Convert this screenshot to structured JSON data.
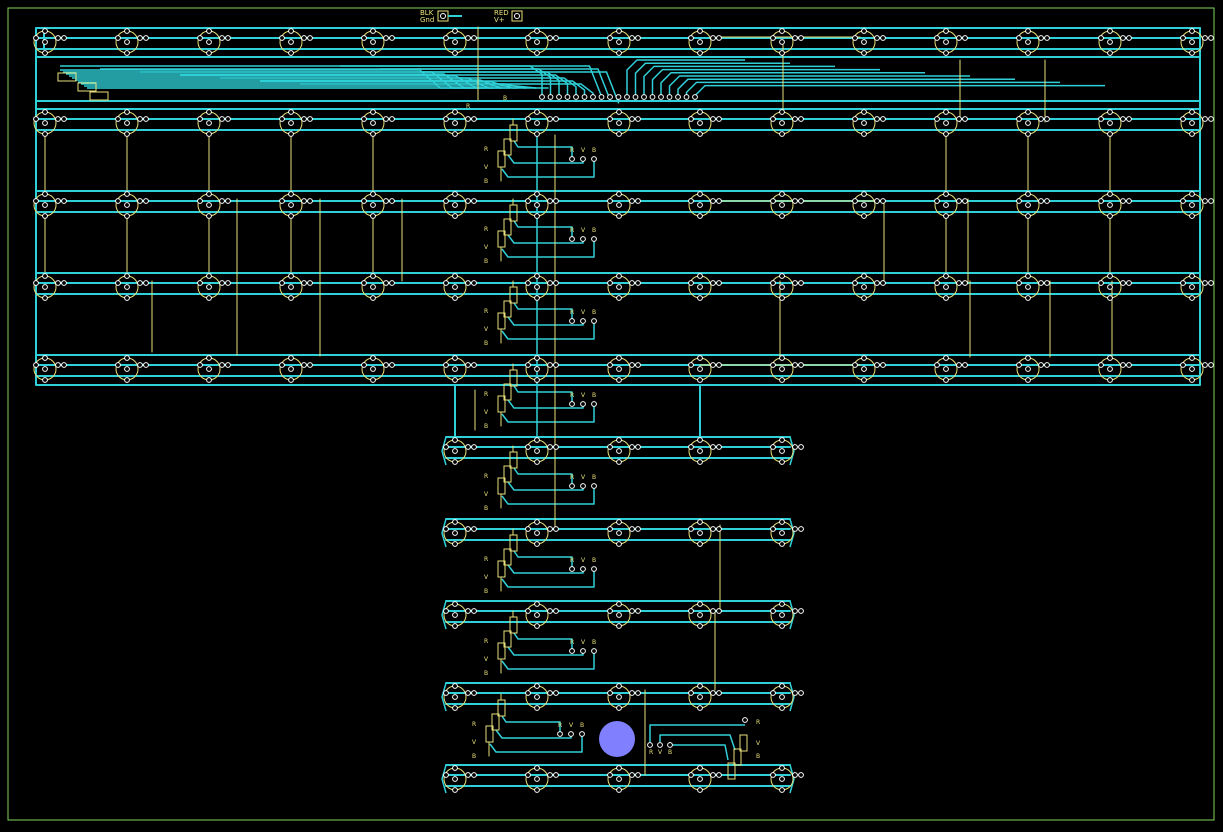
{
  "colors": {
    "background": "#000000",
    "board_outline": "#7ed957",
    "trace": "#2fd0d8",
    "silkscreen": "#e8e07a",
    "pad": "#ffffff",
    "highlight": "#8080ff"
  },
  "connector_labels": {
    "black": "BLK",
    "ground": "Gnd",
    "red": "RED",
    "v_plus": "V+"
  },
  "resistor_labels": {
    "r": "R",
    "v": "V",
    "b": "B"
  },
  "sections": {
    "top_array": "matrix-top-array",
    "stem_array": "matrix-stem-array"
  }
}
